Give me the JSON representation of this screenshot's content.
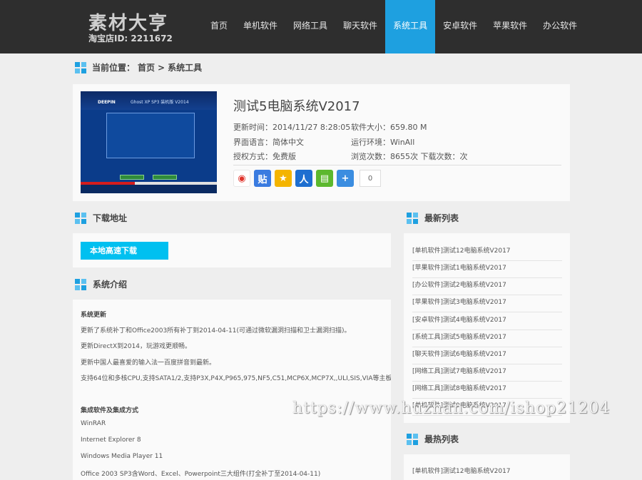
{
  "logo": {
    "main": "素材大亨",
    "sub": "淘宝店ID: 2211672"
  },
  "nav": [
    {
      "label": "首页",
      "active": false
    },
    {
      "label": "单机软件",
      "active": false
    },
    {
      "label": "网络工具",
      "active": false
    },
    {
      "label": "聊天软件",
      "active": false
    },
    {
      "label": "系统工具",
      "active": true
    },
    {
      "label": "安卓软件",
      "active": false
    },
    {
      "label": "苹果软件",
      "active": false
    },
    {
      "label": "办公软件",
      "active": false
    }
  ],
  "breadcrumb": {
    "prefix": "当前位置：",
    "home": "首页",
    "sep": ">",
    "current": "系统工具"
  },
  "product": {
    "title": "测试5电脑系统V2017",
    "update_time": "更新时间：2014/11/27 8:28:05",
    "language": "界面语言：简体中文",
    "license": "授权方式：免费版",
    "size": "软件大小：659.80 M",
    "env": "运行环境：WinAll",
    "views": "浏览次数：8655次  下载次数：次",
    "share_count": "0",
    "share_icons": [
      "weibo-icon",
      "tieba-icon",
      "qzone-icon",
      "renren-icon",
      "wechat-icon",
      "more-share-icon"
    ]
  },
  "download": {
    "heading": "下载地址",
    "button": "本地高速下载"
  },
  "intro": {
    "heading": "系统介绍",
    "lines": [
      "系统更新",
      "更新了系统补丁和Office2003所有补丁到2014-04-11(可通过微软漏洞扫描和卫士漏洞扫描)。",
      "更新DirectX到2014，玩游戏更顺畅。",
      "更新中国人最喜爱的输入法一百度拼音到最新。",
      "支持64位和多核CPU,支持SATA1/2,支持P3X,P4X,P965,975,NF5,C51,MCP6X,MCP7X,,ULI,SIS,VIA等主板。",
      "集成软件及集成方式",
      "WinRAR",
      "Internet Explorer 8",
      "Windows Media Player 11",
      "Office 2003 SP3含Word、Excel、Powerpoint三大组件(打全补丁至2014-04-11)"
    ]
  },
  "latest": {
    "heading": "最新列表",
    "items": [
      "[单机软件]测试12电脑系统V2017",
      "[苹果软件]测试1电脑系统V2017",
      "[办公软件]测试2电脑系统V2017",
      "[苹果软件]测试3电脑系统V2017",
      "[安卓软件]测试4电脑系统V2017",
      "[系统工具]测试5电脑系统V2017",
      "[聊天软件]测试6电脑系统V2017",
      "[网络工具]测试7电脑系统V2017",
      "[网络工具]测试8电脑系统V2017",
      "[单机软件]测试9电脑系统V2017"
    ]
  },
  "hottest": {
    "heading": "最热列表",
    "items": [
      "[单机软件]测试12电脑系统V2017"
    ]
  },
  "watermark": "https://www.huzhan.com/ishop21204"
}
